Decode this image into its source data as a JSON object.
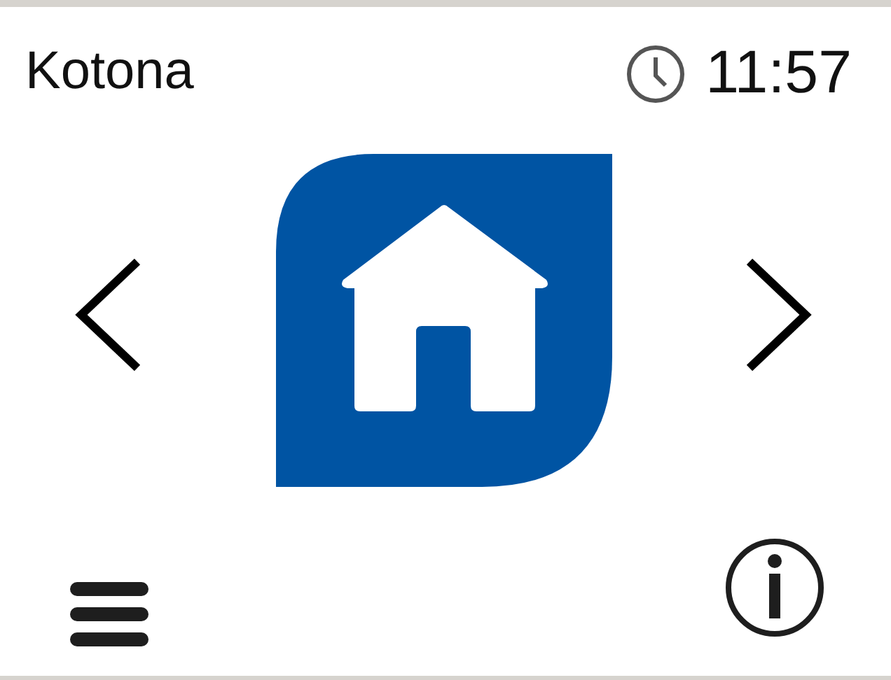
{
  "header": {
    "title": "Kotona",
    "time": "11:57"
  }
}
